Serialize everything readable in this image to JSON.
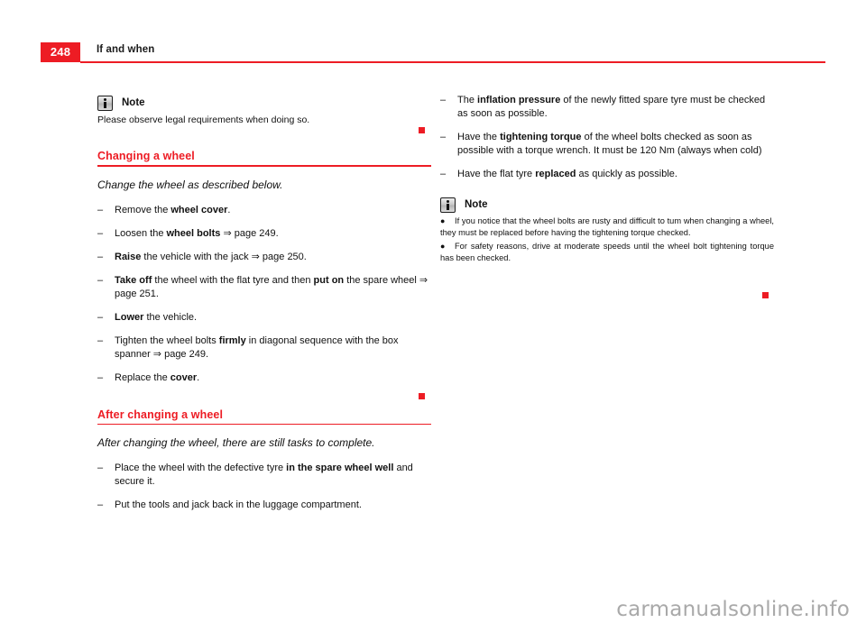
{
  "header": {
    "page_number": "248",
    "title": "If and when",
    "rule_color": "#ED1C24"
  },
  "icons": {
    "note_icon": "info-note-icon",
    "end_marker": "red-square-marker"
  },
  "left_column": {
    "note": {
      "label": "Note",
      "body": "Please observe legal requirements when doing so."
    },
    "sections": [
      {
        "title": "Changing a wheel",
        "intro": "Change the wheel as described below.",
        "items": [
          [
            {
              "t": "Remove the ",
              "b": false
            },
            {
              "t": "wheel cover",
              "b": true
            },
            {
              "t": ".",
              "b": false
            }
          ],
          [
            {
              "t": "Loosen the ",
              "b": false
            },
            {
              "t": "wheel bolts",
              "b": true
            },
            {
              "t": " ⇒ page 249.",
              "b": false
            }
          ],
          [
            {
              "t": "Raise",
              "b": true
            },
            {
              "t": " the vehicle with the jack ⇒ page 250.",
              "b": false
            }
          ],
          [
            {
              "t": "Take off",
              "b": true
            },
            {
              "t": " the wheel with the flat tyre and then ",
              "b": false
            },
            {
              "t": "put on",
              "b": true
            },
            {
              "t": " the spare wheel ⇒ page 251.",
              "b": false
            }
          ],
          [
            {
              "t": "Lower",
              "b": true
            },
            {
              "t": " the vehicle.",
              "b": false
            }
          ],
          [
            {
              "t": "Tighten the wheel bolts ",
              "b": false
            },
            {
              "t": "firmly",
              "b": true
            },
            {
              "t": " in diagonal sequence with the box spanner ⇒ page 249.",
              "b": false
            }
          ],
          [
            {
              "t": "Replace the ",
              "b": false
            },
            {
              "t": "cover",
              "b": true
            },
            {
              "t": ".",
              "b": false
            }
          ]
        ]
      },
      {
        "title": "After changing a wheel",
        "intro": "After changing the wheel, there are still tasks to complete.",
        "items": [
          [
            {
              "t": "Place the wheel with the defective tyre ",
              "b": false
            },
            {
              "t": "in the spare wheel well",
              "b": true
            },
            {
              "t": " and secure it.",
              "b": false
            }
          ],
          [
            {
              "t": "Put the tools and jack back in the luggage compartment.",
              "b": false
            }
          ]
        ]
      }
    ]
  },
  "right_column": {
    "items": [
      [
        {
          "t": "The ",
          "b": false
        },
        {
          "t": "inflation pressure",
          "b": true
        },
        {
          "t": " of the newly fitted spare tyre must be checked as soon as possible.",
          "b": false
        }
      ],
      [
        {
          "t": "Have the ",
          "b": false
        },
        {
          "t": "tightening torque",
          "b": true
        },
        {
          "t": " of the wheel bolts checked as soon as possible with a torque wrench. It must be 120 Nm (always when cold)",
          "b": false
        }
      ],
      [
        {
          "t": "Have the flat tyre ",
          "b": false
        },
        {
          "t": "replaced",
          "b": true
        },
        {
          "t": " as quickly as possible.",
          "b": false
        }
      ]
    ],
    "note": {
      "label": "Note",
      "bullets": [
        "If you notice that the wheel bolts are rusty and difficult to tum when changing a wheel, they must be replaced before having the tightening torque checked.",
        "For safety reasons, drive at moderate speeds until the wheel bolt tightening torque has been checked."
      ]
    }
  },
  "dash_mark": "–",
  "bullet_mark": "●",
  "watermark": "carmanualsonline.info"
}
